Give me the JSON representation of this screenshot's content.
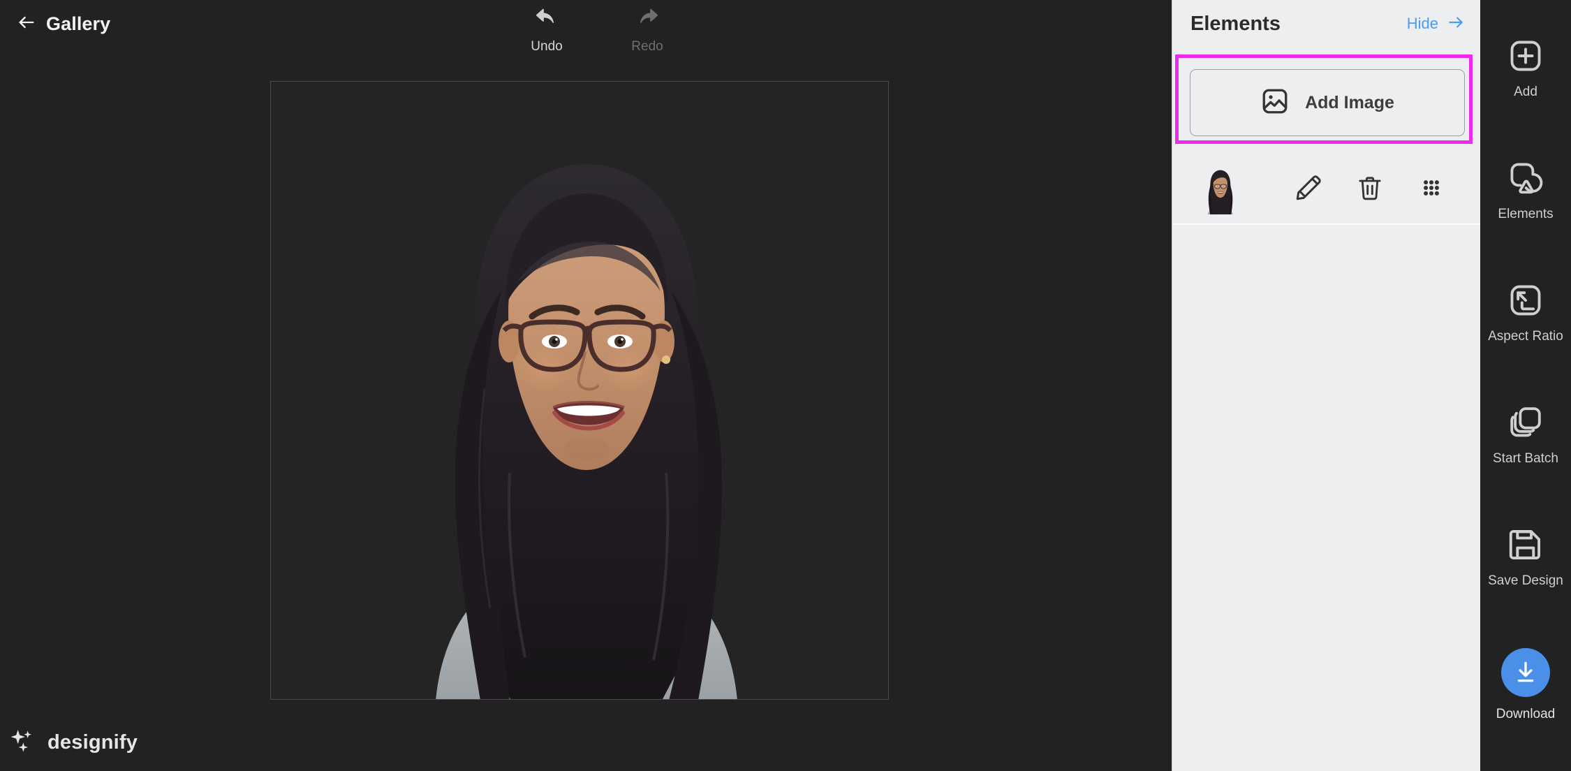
{
  "topbar": {
    "back_label": "Gallery",
    "back_icon": "arrow-left-icon",
    "undo": {
      "label": "Undo",
      "icon": "undo-arrow-icon",
      "enabled": true
    },
    "redo": {
      "label": "Redo",
      "icon": "redo-arrow-icon",
      "enabled": false
    }
  },
  "canvas": {
    "background_color": "#242424",
    "border_color": "#4a4a4a",
    "content": "portrait-photo-woman-with-glasses"
  },
  "brand": {
    "name": "designify",
    "icon": "sparkles-icon"
  },
  "panel": {
    "title": "Elements",
    "hide_label": "Hide",
    "hide_icon": "arrow-right-icon",
    "background_color": "#edeef0",
    "add_image": {
      "label": "Add Image",
      "icon": "image-icon",
      "highlight_color": "#ee2aee",
      "highlighted": true
    },
    "element_row": {
      "thumbnail": "portrait-photo-thumbnail",
      "actions": [
        {
          "name": "edit",
          "icon": "pencil-icon"
        },
        {
          "name": "delete",
          "icon": "trash-icon"
        },
        {
          "name": "reorder",
          "icon": "drag-dots-icon"
        }
      ]
    }
  },
  "rail": {
    "accent_color": "#4a90e8",
    "items": [
      {
        "label": "Add",
        "icon": "plus-square-icon"
      },
      {
        "label": "Elements",
        "icon": "shapes-icon"
      },
      {
        "label": "Aspect Ratio",
        "icon": "aspect-ratio-icon"
      },
      {
        "label": "Start Batch",
        "icon": "stack-icon"
      },
      {
        "label": "Save Design",
        "icon": "floppy-disk-icon"
      },
      {
        "label": "Download",
        "icon": "download-arrow-icon"
      }
    ]
  }
}
